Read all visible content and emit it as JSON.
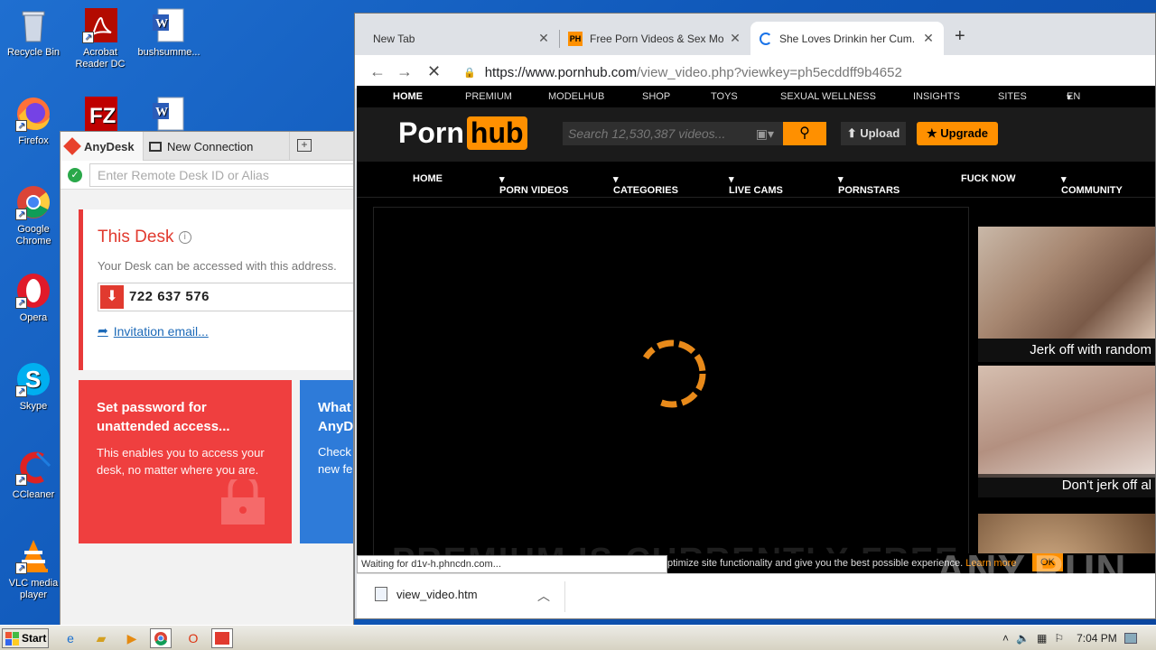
{
  "desktop": {
    "icons": [
      {
        "label": "Recycle Bin"
      },
      {
        "label": "Acrobat Reader DC"
      },
      {
        "label": "bushsumme..."
      },
      {
        "label": "Firefox"
      },
      {
        "label": "Google Chrome"
      },
      {
        "label": "Opera"
      },
      {
        "label": "Skype"
      },
      {
        "label": "CCleaner"
      },
      {
        "label": "VLC media player"
      }
    ]
  },
  "anydesk": {
    "tab_app": "AnyDesk",
    "tab_new": "New Connection",
    "remote_placeholder": "Enter Remote Desk ID or Alias",
    "this_desk_title": "This Desk",
    "this_desk_sub": "Your Desk can be accessed with this address.",
    "desk_id": "722 637 576",
    "invitation": "Invitation email...",
    "card_password": {
      "title": "Set password for unattended access...",
      "text": "This enables you to access your desk, no matter where you are."
    },
    "card_new": {
      "title1": "What",
      "title2": "AnyD",
      "text1": "Check",
      "text2": "new fe"
    }
  },
  "browser": {
    "tabs": [
      {
        "title": "New Tab"
      },
      {
        "title": "Free Porn Videos & Sex Movies - Porno, XXX"
      },
      {
        "title": "She Loves Drinkin her Cum. Hard Anal"
      }
    ],
    "url_host": "https://www.pornhub.com",
    "url_path": "/view_video.php?viewkey=ph5ecddff9b4652",
    "status_text": "Waiting for d1v-h.phncdn.com...",
    "download_file": "view_video.htm"
  },
  "site": {
    "top_nav": [
      "HOME",
      "PREMIUM",
      "MODELHUB",
      "SHOP",
      "TOYS",
      "SEXUAL WELLNESS",
      "INSIGHTS",
      "SITES",
      "EN"
    ],
    "logo_a": "Porn",
    "logo_b": "hub",
    "search_placeholder": "Search 12,530,387 videos...",
    "upload": "Upload",
    "upgrade": "Upgrade",
    "main_nav": [
      "HOME",
      "PORN VIDEOS",
      "CATEGORIES",
      "LIVE CAMS",
      "PORNSTARS",
      "FUCK NOW",
      "COMMUNITY"
    ],
    "video_banner": "PREMIUM IS CURRENTLY FREE",
    "thumbs": [
      "Jerk off with random",
      "Don't jerk off al"
    ],
    "cookie_text": "ptimize site functionality and give you the best possible experience.",
    "cookie_link": "Learn more",
    "cookie_ok": "OK"
  },
  "watermark": "ANY.RUN",
  "taskbar": {
    "start": "Start",
    "clock": "7:04 PM"
  },
  "colors": {
    "desktop_bg": "#1464c8",
    "anydesk_red": "#ef3f3f",
    "anydesk_blue": "#2e7bd9",
    "ph_orange": "#ff9000"
  }
}
